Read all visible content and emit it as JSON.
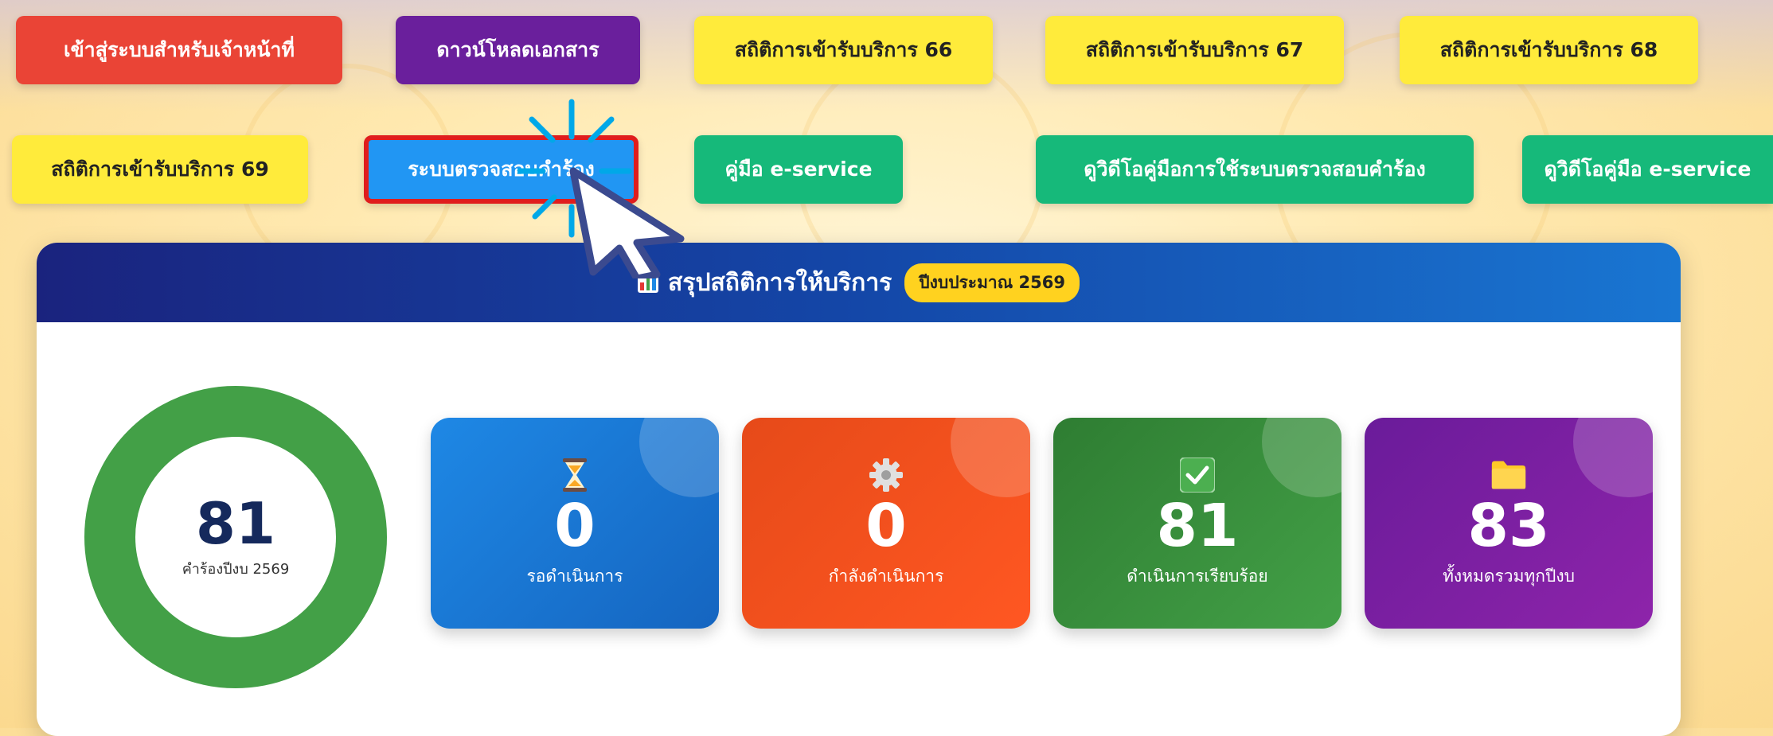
{
  "nav": {
    "row1": [
      {
        "label": "เข้าสู่ระบบสำหรับเจ้าหน้าที่"
      },
      {
        "label": "ดาวน์โหลดเอกสาร"
      },
      {
        "label": "สถิติการเข้ารับบริการ 66"
      },
      {
        "label": "สถิติการเข้ารับบริการ 67"
      },
      {
        "label": "สถิติการเข้ารับบริการ 68"
      }
    ],
    "row2": [
      {
        "label": "สถิติการเข้ารับบริการ 69"
      },
      {
        "label": "ระบบตรวจสอบคำร้อง"
      },
      {
        "label": "คู่มือ e-service"
      },
      {
        "label": "ดูวิดีโอคู่มือการใช้ระบบตรวจสอบคำร้อง"
      },
      {
        "label": "ดูวิดีโอคู่มือ e-service"
      }
    ]
  },
  "summary": {
    "title": "สรุปสถิติการให้บริการ",
    "badge": "ปีงบประมาณ 2569",
    "donut": {
      "value": "81",
      "label": "คำร้องปีงบ 2569",
      "fraction": 1.0
    },
    "stats": [
      {
        "value": "0",
        "label": "รอดำเนินการ",
        "icon": "hourglass-icon"
      },
      {
        "value": "0",
        "label": "กำลังดำเนินการ",
        "icon": "gear-icon"
      },
      {
        "value": "81",
        "label": "ดำเนินการเรียบร้อย",
        "icon": "check-icon"
      },
      {
        "value": "83",
        "label": "ทั้งหมดรวมทุกปีงบ",
        "icon": "folder-icon"
      }
    ]
  },
  "colors": {
    "red": "#ea4436",
    "purple": "#6a1f9c",
    "yellow": "#ffeb3b",
    "blue": "#2196f3",
    "green": "#16b97a",
    "donut": "#43a047",
    "highlight": "#e01d1d"
  }
}
